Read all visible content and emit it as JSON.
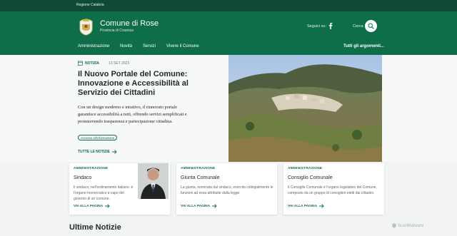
{
  "topbar": {
    "region": "Regione Calabria"
  },
  "header": {
    "site_name": "Comune di Rose",
    "site_sub": "Provincia di Cosenza",
    "social_label": "Seguici su:",
    "search_label": "Cerca"
  },
  "nav": {
    "items": [
      "Amministrazione",
      "Novità",
      "Servizi",
      "Vivere il Comune"
    ],
    "all": "Tutti gli argomenti..."
  },
  "hero": {
    "tag": "NOTIZIA",
    "date": "13 SET 2023",
    "title": "Il Nuovo Portale del Comune: Innovazione e Accessibilità al Servizio dei Cittadini",
    "text": "Con un design moderno e intuitivo, il rinnovato portale garantisce accessibilità a tutti, offrendo servizi semplificati e promuovendo trasparenza e partecipazione cittadina.",
    "chip": "Accesso all'informazione",
    "all_news": "TUTTE LE NOTIZIE"
  },
  "cards": [
    {
      "category": "AMMINISTRAZIONE",
      "title": "Sindaco",
      "desc": "Il sindaco, nell'ordinamento italiano, è l'organo monocratico a capo del governo di un comune.",
      "link": "VAI ALLA PAGINA"
    },
    {
      "category": "AMMINISTRAZIONE",
      "title": "Giunta Comunale",
      "desc": "La giunta, nominata dal sindaco, esercita collegialmente le funzioni ad essa attribuite dalla legge.",
      "link": "VAI ALLA PAGINA"
    },
    {
      "category": "AMMINISTRAZIONE",
      "title": "Consiglio Comunale",
      "desc": "Il Consiglio Comunale è l'organo legislativo del Comune, composto da un gruppo di consiglieri eletti dai cittadini.",
      "link": "VAI ALLA PAGINA"
    }
  ],
  "section_title": "Ultime Notizie",
  "watermark": "ScanMalware",
  "colors": {
    "brand": "#0f6e4a",
    "brand_dark": "#0f4a35"
  },
  "icons": [
    "crest-icon",
    "facebook-icon",
    "search-icon",
    "calendar-icon",
    "arrow-right-icon"
  ]
}
